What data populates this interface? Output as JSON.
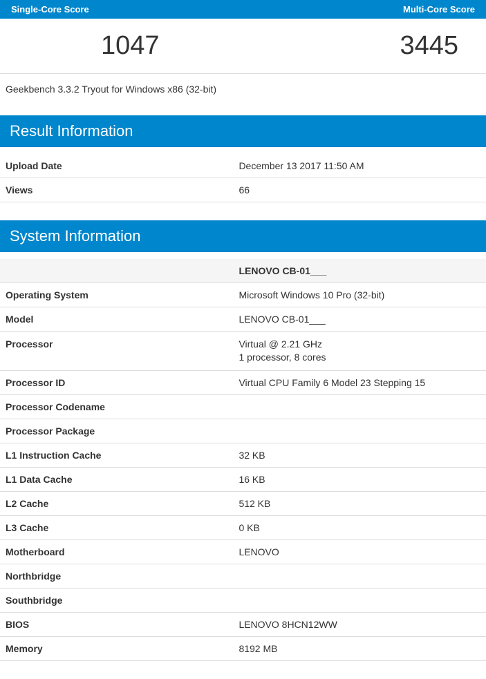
{
  "scores": {
    "single_label": "Single-Core Score",
    "multi_label": "Multi-Core Score",
    "single": "1047",
    "multi": "3445"
  },
  "version_line": "Geekbench 3.3.2 Tryout for Windows x86 (32-bit)",
  "result_info": {
    "title": "Result Information",
    "rows": [
      {
        "key": "Upload Date",
        "value": "December 13 2017 11:50 AM"
      },
      {
        "key": "Views",
        "value": "66"
      }
    ]
  },
  "system_info": {
    "title": "System Information",
    "header_value": "LENOVO CB-01___",
    "rows": [
      {
        "key": "Operating System",
        "value": "Microsoft Windows 10 Pro (32-bit)"
      },
      {
        "key": "Model",
        "value": "LENOVO CB-01___"
      },
      {
        "key": "Processor",
        "value": "Virtual @ 2.21 GHz\n1 processor, 8 cores"
      },
      {
        "key": "Processor ID",
        "value": "Virtual CPU Family 6 Model 23 Stepping 15"
      },
      {
        "key": "Processor Codename",
        "value": ""
      },
      {
        "key": "Processor Package",
        "value": ""
      },
      {
        "key": "L1 Instruction Cache",
        "value": "32 KB"
      },
      {
        "key": "L1 Data Cache",
        "value": "16 KB"
      },
      {
        "key": "L2 Cache",
        "value": "512 KB"
      },
      {
        "key": "L3 Cache",
        "value": "0 KB"
      },
      {
        "key": "Motherboard",
        "value": "LENOVO"
      },
      {
        "key": "Northbridge",
        "value": ""
      },
      {
        "key": "Southbridge",
        "value": ""
      },
      {
        "key": "BIOS",
        "value": "LENOVO 8HCN12WW"
      },
      {
        "key": "Memory",
        "value": "8192 MB"
      }
    ]
  }
}
